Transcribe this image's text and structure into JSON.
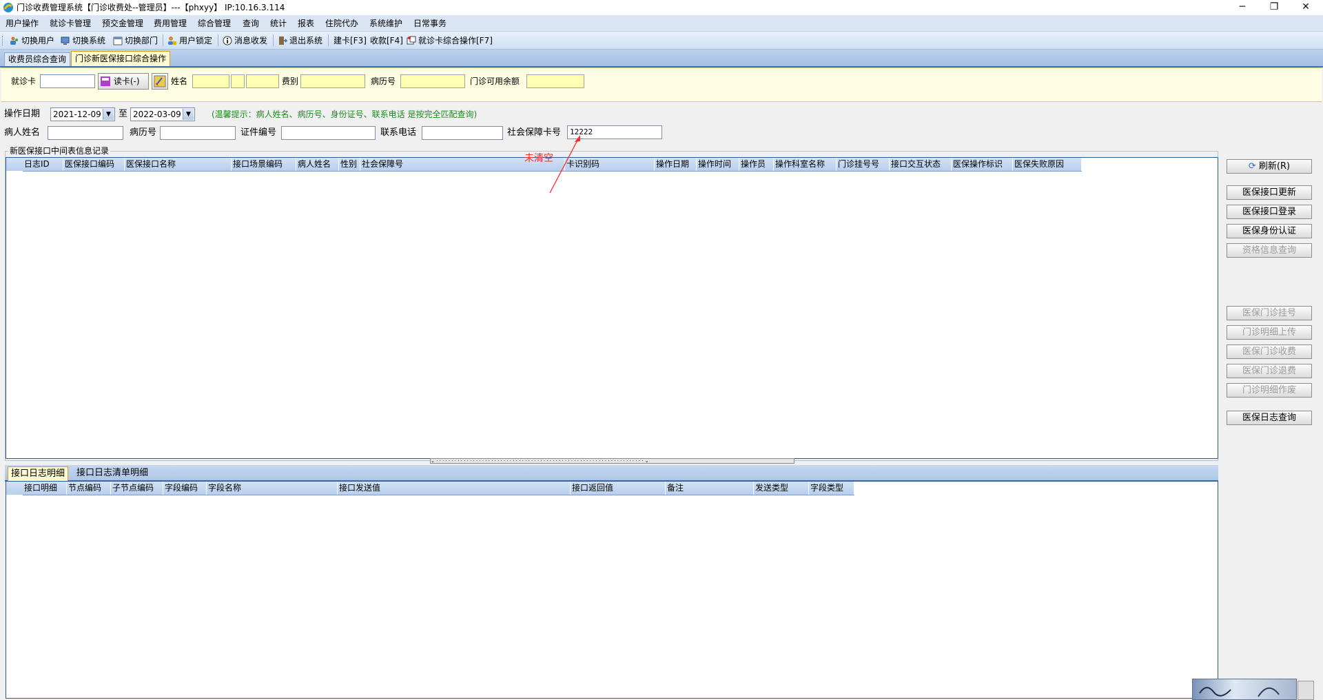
{
  "window": {
    "title": "门诊收费管理系统【门诊收费处--管理员】---【phxyy】 IP:10.16.3.114",
    "controls": [
      "─",
      "❐",
      "✕"
    ]
  },
  "menu": [
    "用户操作",
    "就诊卡管理",
    "预交金管理",
    "费用管理",
    "综合管理",
    "查询",
    "统计",
    "报表",
    "住院代办",
    "系统维护",
    "日常事务"
  ],
  "toolbar": {
    "switch_user": "切换用户",
    "switch_system": "切换系统",
    "switch_dept": "切换部门",
    "lock_user": "用户锁定",
    "messages": "消息收发",
    "exit": "退出系统",
    "build_card": "建卡[F3]",
    "charge": "收款[F4]",
    "card_ops": "就诊卡综合操作[F7]"
  },
  "tabs": [
    "收费员综合查询",
    "门诊新医保接口综合操作"
  ],
  "patient_bar": {
    "card_label": "就诊卡",
    "card_value": "",
    "read_card": "读卡(-)",
    "name_label": "姓名",
    "fee_type_label": "费别",
    "record_label": "病历号",
    "balance_label": "门诊可用余额"
  },
  "filters": {
    "date_label": "操作日期",
    "date_from": "2021-12-09",
    "to_label": "至",
    "date_to": "2022-03-09",
    "hint": "(温馨提示：病人姓名、病历号、身份证号、联系电话 是按完全匹配查询)",
    "patient_name_label": "病人姓名",
    "record_no_label": "病历号",
    "id_no_label": "证件编号",
    "phone_label": "联系电话",
    "ssn_label": "社会保障卡号",
    "ssn_value": "12222"
  },
  "annotation": "未清空",
  "group_title": "新医保接口中间表信息记录",
  "main_columns": [
    "日志ID",
    "医保接口编码",
    "医保接口名称",
    "接口场景编码",
    "病人姓名",
    "性别",
    "社会保障号",
    "卡识别码",
    "操作日期",
    "操作时间",
    "操作员",
    "操作科室名称",
    "门诊挂号号",
    "接口交互状态",
    "医保操作标识",
    "医保失败原因"
  ],
  "side_buttons": {
    "refresh": "刷新(R)",
    "update": "医保接口更新",
    "login": "医保接口登录",
    "auth": "医保身份认证",
    "qualification": "资格信息查询",
    "register": "医保门诊挂号",
    "upload": "门诊明细上传",
    "charge": "医保门诊收费",
    "refund": "医保门诊退费",
    "void_detail": "门诊明细作废",
    "log_query": "医保日志查询"
  },
  "bottom_tabs": [
    "接口日志明细",
    "接口日志清单明细"
  ],
  "detail_columns": [
    "接口明细",
    "节点编码",
    "子节点编码",
    "字段编码",
    "字段名称",
    "接口发送值",
    "接口返回值",
    "备注",
    "发送类型",
    "字段类型"
  ],
  "colors": {
    "annotation": "#ff2a2a",
    "grid_border": "#2b5a9b",
    "input_yellow": "#ffffb4"
  }
}
